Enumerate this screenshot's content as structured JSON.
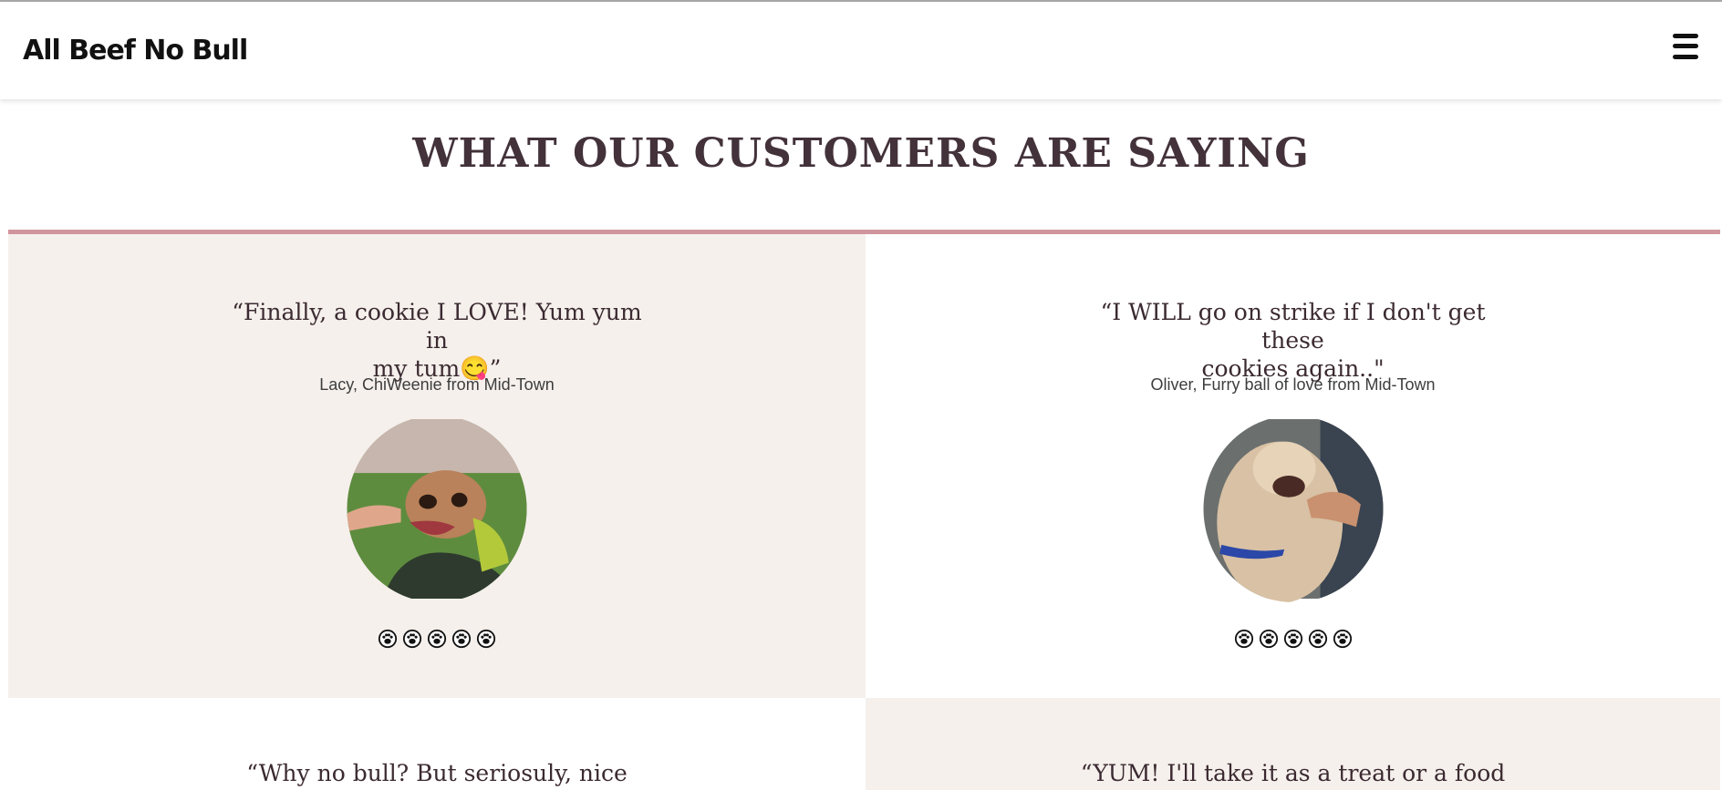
{
  "header": {
    "brand": "All Beef No Bull",
    "menu_icon": "hamburger-menu-icon"
  },
  "section": {
    "title": "WHAT OUR CUSTOMERS ARE SAYING"
  },
  "colors": {
    "divider": "#d0959c",
    "tinted_card": "#f5f0ec",
    "title_text": "#43323a"
  },
  "testimonials": [
    {
      "quote_line1": "“Finally, a cookie I LOVE! Yum yum in",
      "quote_line2": "my tum",
      "emoji": "😋",
      "quote_end": "”",
      "author": "Lacy, ChiWeenie from Mid-Town",
      "photo": "small tan dog eating a treat",
      "rating": 5,
      "rating_icon": "paw-print-icon"
    },
    {
      "quote_line1": "“I WILL go on strike if I don't get these",
      "quote_line2": "cookies again..",
      "emoji": "",
      "quote_end": "\"",
      "author": "Oliver, Furry ball of love from Mid-Town",
      "photo": "fluffy cream dog eating a treat",
      "rating": 5,
      "rating_icon": "paw-print-icon"
    },
    {
      "quote_line1": "“Why no bull? But seriosuly, nice and"
    },
    {
      "quote_line1": "“YUM! I'll take it as a treat or a food"
    }
  ]
}
